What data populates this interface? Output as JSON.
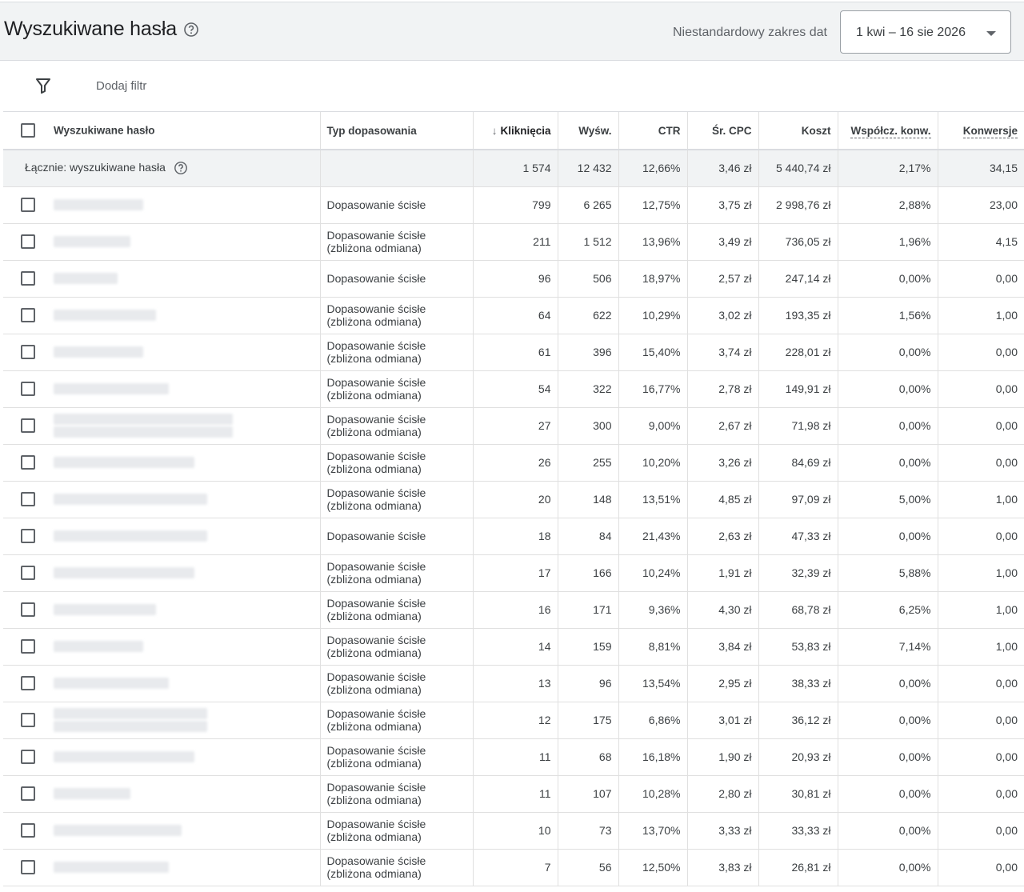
{
  "header": {
    "title": "Wyszukiwane hasła",
    "date_range_label": "Niestandardowy zakres dat",
    "date_range_value": "1 kwi – 16 sie 2026"
  },
  "filter": {
    "label": "Dodaj filtr"
  },
  "table": {
    "columns": {
      "term": "Wyszukiwane hasło",
      "match": "Typ dopasowania",
      "clicks": "Kliknięcia",
      "impr": "Wyśw.",
      "ctr": "CTR",
      "cpc": "Śr. CPC",
      "cost": "Koszt",
      "convrate": "Współcz. konw.",
      "conv": "Konwersje"
    },
    "total": {
      "label": "Łącznie: wyszukiwane hasła",
      "clicks": "1 574",
      "impr": "12 432",
      "ctr": "12,66%",
      "cpc": "3,46 zł",
      "cost": "5 440,74 zł",
      "convrate": "2,17%",
      "conv": "34,15"
    },
    "rows": [
      {
        "match_1": "Dopasowanie ścisłe",
        "match_2": "",
        "clicks": "799",
        "impr": "6 265",
        "ctr": "12,75%",
        "cpc": "3,75 zł",
        "cost": "2 998,76 zł",
        "convrate": "2,88%",
        "conv": "23,00"
      },
      {
        "match_1": "Dopasowanie ścisłe",
        "match_2": "(zbliżona odmiana)",
        "clicks": "211",
        "impr": "1 512",
        "ctr": "13,96%",
        "cpc": "3,49 zł",
        "cost": "736,05 zł",
        "convrate": "1,96%",
        "conv": "4,15"
      },
      {
        "match_1": "Dopasowanie ścisłe",
        "match_2": "",
        "clicks": "96",
        "impr": "506",
        "ctr": "18,97%",
        "cpc": "2,57 zł",
        "cost": "247,14 zł",
        "convrate": "0,00%",
        "conv": "0,00"
      },
      {
        "match_1": "Dopasowanie ścisłe",
        "match_2": "(zbliżona odmiana)",
        "clicks": "64",
        "impr": "622",
        "ctr": "10,29%",
        "cpc": "3,02 zł",
        "cost": "193,35 zł",
        "convrate": "1,56%",
        "conv": "1,00"
      },
      {
        "match_1": "Dopasowanie ścisłe",
        "match_2": "(zbliżona odmiana)",
        "clicks": "61",
        "impr": "396",
        "ctr": "15,40%",
        "cpc": "3,74 zł",
        "cost": "228,01 zł",
        "convrate": "0,00%",
        "conv": "0,00"
      },
      {
        "match_1": "Dopasowanie ścisłe",
        "match_2": "(zbliżona odmiana)",
        "clicks": "54",
        "impr": "322",
        "ctr": "16,77%",
        "cpc": "2,78 zł",
        "cost": "149,91 zł",
        "convrate": "0,00%",
        "conv": "0,00"
      },
      {
        "match_1": "Dopasowanie ścisłe",
        "match_2": "(zbliżona odmiana)",
        "clicks": "27",
        "impr": "300",
        "ctr": "9,00%",
        "cpc": "2,67 zł",
        "cost": "71,98 zł",
        "convrate": "0,00%",
        "conv": "0,00"
      },
      {
        "match_1": "Dopasowanie ścisłe",
        "match_2": "(zbliżona odmiana)",
        "clicks": "26",
        "impr": "255",
        "ctr": "10,20%",
        "cpc": "3,26 zł",
        "cost": "84,69 zł",
        "convrate": "0,00%",
        "conv": "0,00"
      },
      {
        "match_1": "Dopasowanie ścisłe",
        "match_2": "(zbliżona odmiana)",
        "clicks": "20",
        "impr": "148",
        "ctr": "13,51%",
        "cpc": "4,85 zł",
        "cost": "97,09 zł",
        "convrate": "5,00%",
        "conv": "1,00"
      },
      {
        "match_1": "Dopasowanie ścisłe",
        "match_2": "",
        "clicks": "18",
        "impr": "84",
        "ctr": "21,43%",
        "cpc": "2,63 zł",
        "cost": "47,33 zł",
        "convrate": "0,00%",
        "conv": "0,00"
      },
      {
        "match_1": "Dopasowanie ścisłe",
        "match_2": "(zbliżona odmiana)",
        "clicks": "17",
        "impr": "166",
        "ctr": "10,24%",
        "cpc": "1,91 zł",
        "cost": "32,39 zł",
        "convrate": "5,88%",
        "conv": "1,00"
      },
      {
        "match_1": "Dopasowanie ścisłe",
        "match_2": "(zbliżona odmiana)",
        "clicks": "16",
        "impr": "171",
        "ctr": "9,36%",
        "cpc": "4,30 zł",
        "cost": "68,78 zł",
        "convrate": "6,25%",
        "conv": "1,00"
      },
      {
        "match_1": "Dopasowanie ścisłe",
        "match_2": "(zbliżona odmiana)",
        "clicks": "14",
        "impr": "159",
        "ctr": "8,81%",
        "cpc": "3,84 zł",
        "cost": "53,83 zł",
        "convrate": "7,14%",
        "conv": "1,00"
      },
      {
        "match_1": "Dopasowanie ścisłe",
        "match_2": "(zbliżona odmiana)",
        "clicks": "13",
        "impr": "96",
        "ctr": "13,54%",
        "cpc": "2,95 zł",
        "cost": "38,33 zł",
        "convrate": "0,00%",
        "conv": "0,00"
      },
      {
        "match_1": "Dopasowanie ścisłe",
        "match_2": "(zbliżona odmiana)",
        "clicks": "12",
        "impr": "175",
        "ctr": "6,86%",
        "cpc": "3,01 zł",
        "cost": "36,12 zł",
        "convrate": "0,00%",
        "conv": "0,00"
      },
      {
        "match_1": "Dopasowanie ścisłe",
        "match_2": "(zbliżona odmiana)",
        "clicks": "11",
        "impr": "68",
        "ctr": "16,18%",
        "cpc": "1,90 zł",
        "cost": "20,93 zł",
        "convrate": "0,00%",
        "conv": "0,00"
      },
      {
        "match_1": "Dopasowanie ścisłe",
        "match_2": "(zbliżona odmiana)",
        "clicks": "11",
        "impr": "107",
        "ctr": "10,28%",
        "cpc": "2,80 zł",
        "cost": "30,81 zł",
        "convrate": "0,00%",
        "conv": "0,00"
      },
      {
        "match_1": "Dopasowanie ścisłe",
        "match_2": "(zbliżona odmiana)",
        "clicks": "10",
        "impr": "73",
        "ctr": "13,70%",
        "cpc": "3,33 zł",
        "cost": "33,33 zł",
        "convrate": "0,00%",
        "conv": "0,00"
      },
      {
        "match_1": "Dopasowanie ścisłe",
        "match_2": "(zbliżona odmiana)",
        "clicks": "7",
        "impr": "56",
        "ctr": "12,50%",
        "cpc": "3,83 zł",
        "cost": "26,81 zł",
        "convrate": "0,00%",
        "conv": "0,00"
      }
    ]
  }
}
